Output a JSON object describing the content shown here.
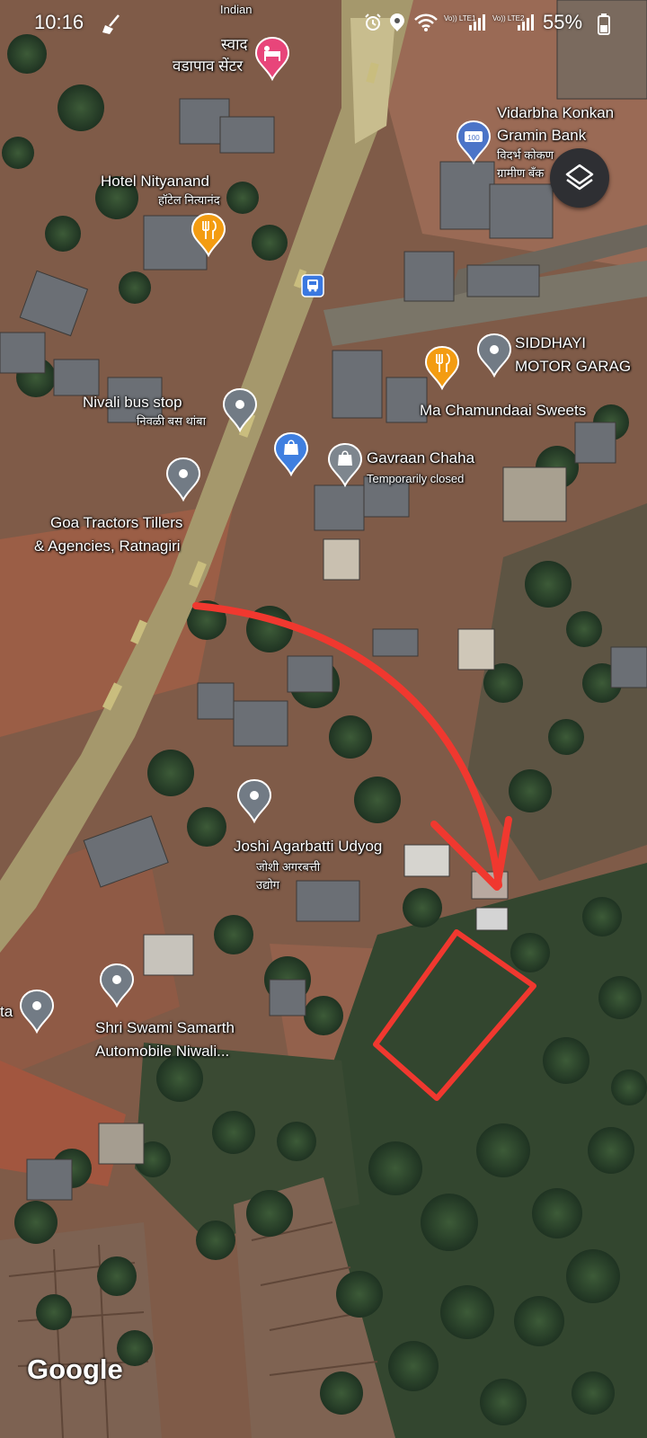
{
  "status_bar": {
    "time": "10:16",
    "battery": "55%",
    "sim1": "Vo)) LTE1",
    "sim2": "Vo)) LTE2",
    "icons": [
      "broom-icon",
      "alarm-icon",
      "location-icon",
      "wifi-icon",
      "signal-icon",
      "battery-icon"
    ]
  },
  "map": {
    "places": [
      {
        "name": "Indian",
        "subtitle": "",
        "icon": "none"
      },
      {
        "name": "स्वाद",
        "subtitle": "वडापाव सेंटर",
        "icon": "bed-icon"
      },
      {
        "name": "Hotel Nityanand",
        "subtitle": "हॉटेल नित्यानंद",
        "icon": "restaurant-icon"
      },
      {
        "name": "Vidarbha Konkan",
        "subtitle": "Gramin Bank",
        "subtitle2": "विदर्भ कोकण",
        "subtitle3": "ग्रामीण बँक",
        "icon": "bank-icon"
      },
      {
        "name": "SIDDHAYI",
        "subtitle": "MOTOR GARAG",
        "icon": "place-icon"
      },
      {
        "name": "Ma Chamundaai Sweets",
        "subtitle": "",
        "icon": "restaurant-icon"
      },
      {
        "name": "Nivali bus stop",
        "subtitle": "निवळी बस थांबा",
        "icon": "place-icon"
      },
      {
        "name": "Gavraan Chaha",
        "subtitle": "Temporarily closed",
        "icon": "shopping-icon"
      },
      {
        "name": "Goa Tractors Tillers",
        "subtitle": "& Agencies, Ratnagiri",
        "icon": "place-icon"
      },
      {
        "name": "Joshi Agarbatti Udyog",
        "subtitle": "जोशी अगरबत्ती",
        "subtitle2": "उद्योग",
        "icon": "place-icon"
      },
      {
        "name": "Shri Swami Samarth",
        "subtitle": "Automobile Niwali...",
        "icon": "place-icon"
      },
      {
        "name": "ta",
        "subtitle": "",
        "icon": "place-icon"
      }
    ],
    "bus_stop_icon": "bus-icon",
    "shopping_icon": "shopping-bag-icon",
    "annotation": {
      "arrow": "red-arrow",
      "boundary": "red-plot-outline"
    },
    "attribution": "Google",
    "colors": {
      "annotation": "#f0382f",
      "road": "#a79a6a",
      "soil": "#8a5a43",
      "vegetation": "#2f4a30"
    }
  },
  "controls": {
    "layers_button": "layers-icon"
  }
}
